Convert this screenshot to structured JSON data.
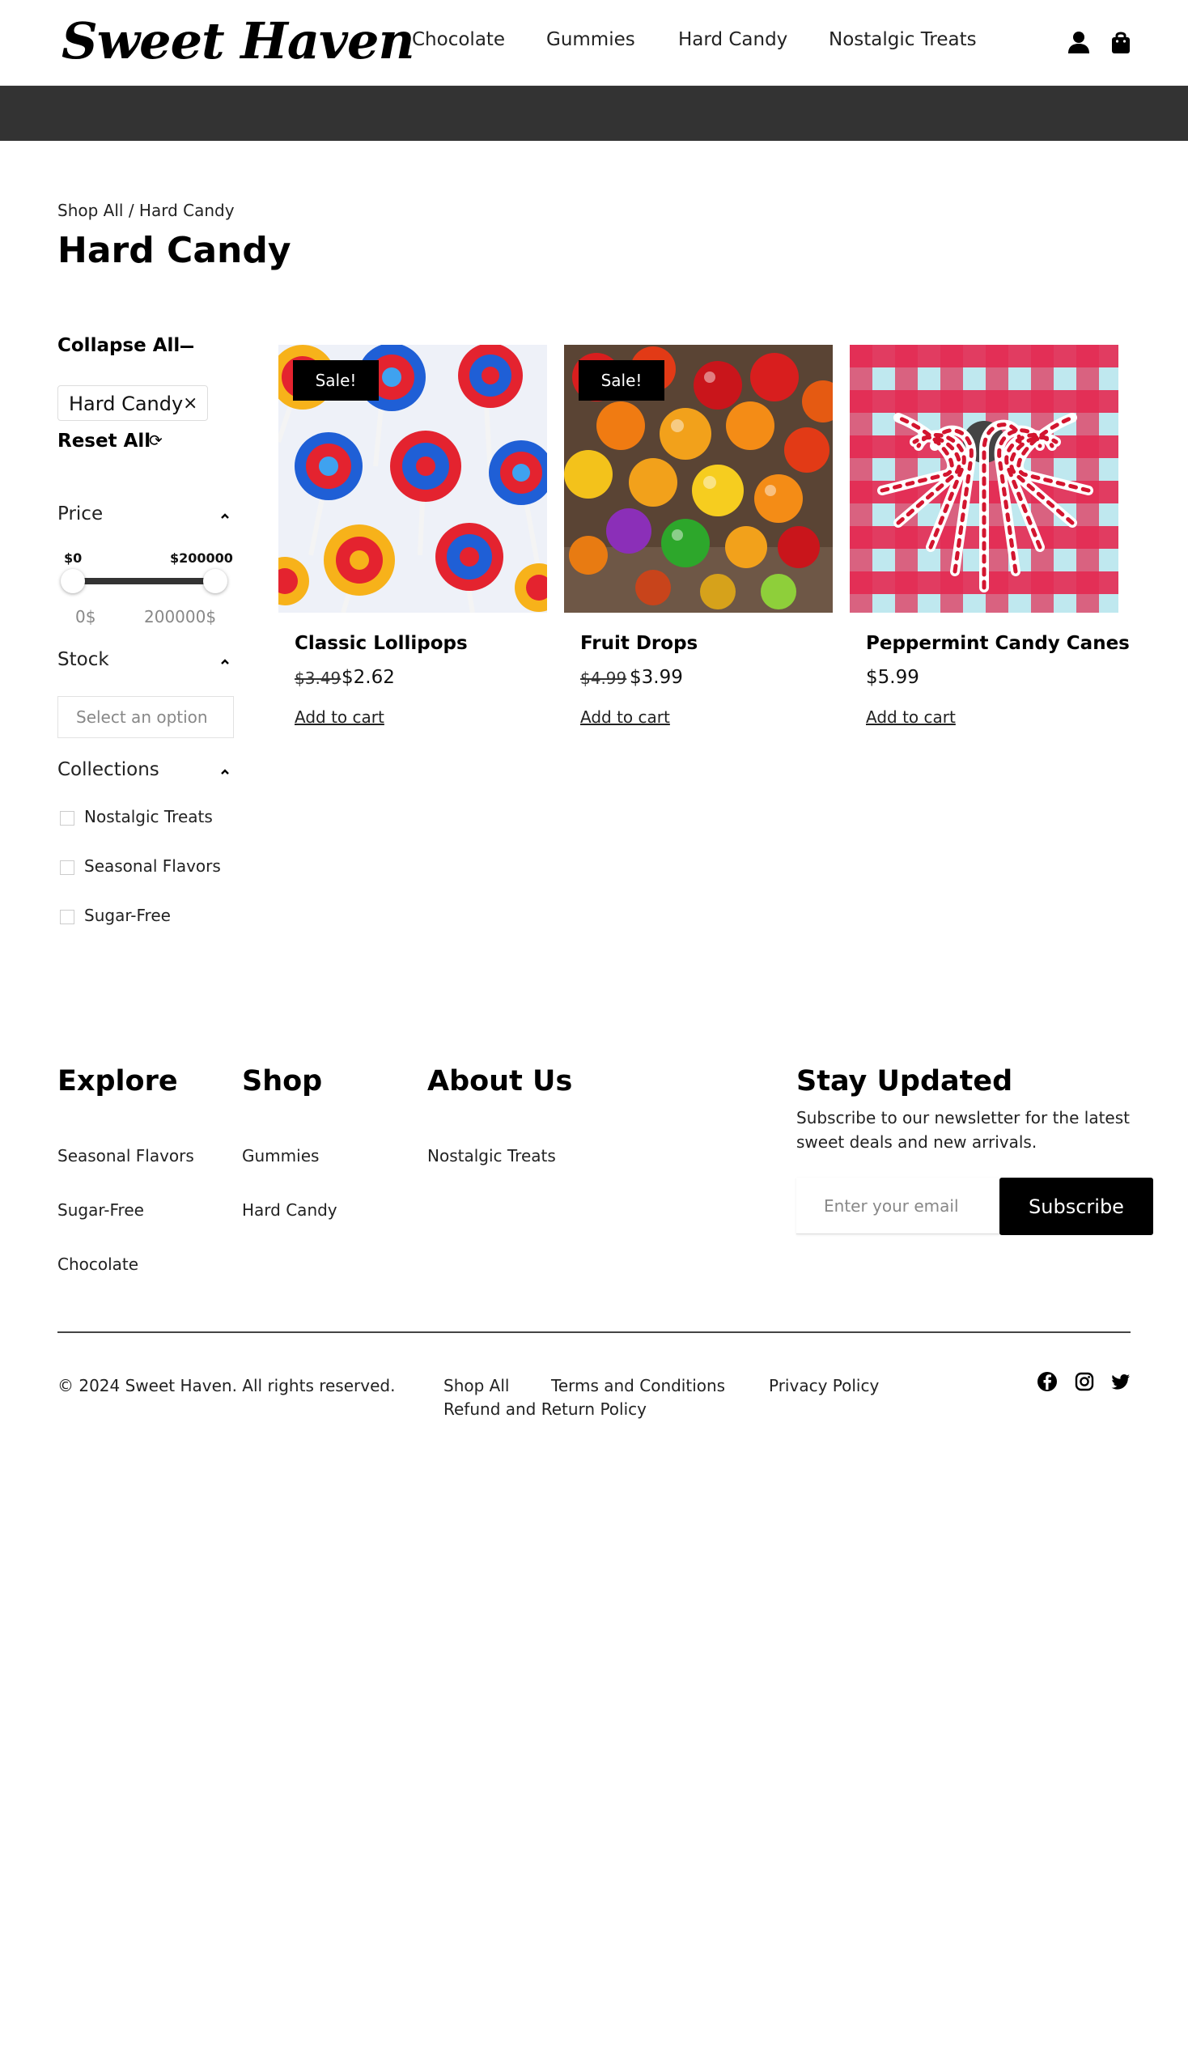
{
  "brand": {
    "logo": "Sweet Haven"
  },
  "nav": {
    "items": [
      "Chocolate",
      "Gummies",
      "Hard Candy",
      "Nostalgic Treats"
    ]
  },
  "header_icons": [
    "user-icon",
    "shopping-bag-icon"
  ],
  "breadcrumb": "Shop All / Hard Candy",
  "page_title": "Hard Candy",
  "filters": {
    "collapse_all": "Collapse All",
    "active_chip": "Hard Candy",
    "chip_close": "×",
    "reset_all": "Reset All",
    "reset_icon": "⟳",
    "price": {
      "heading": "Price",
      "min_label": "$0",
      "max_label": "$200000",
      "range_min_text": "0$",
      "range_max_text": "200000$"
    },
    "stock": {
      "heading": "Stock",
      "placeholder": "Select an option"
    },
    "collections": {
      "heading": "Collections",
      "options": [
        "Nostalgic Treats",
        "Seasonal Flavors",
        "Sugar-Free"
      ]
    }
  },
  "products": [
    {
      "name": "Classic Lollipops",
      "sale_badge": "Sale!",
      "old_price": "$3.49",
      "price": "$2.62",
      "cta": "Add to cart"
    },
    {
      "name": "Fruit Drops",
      "sale_badge": "Sale!",
      "old_price": "$4.99",
      "price": "$3.99",
      "cta": "Add to cart"
    },
    {
      "name": "Peppermint Candy Canes",
      "price": "$5.99",
      "cta": "Add to cart"
    }
  ],
  "footer": {
    "explore": {
      "heading": "Explore",
      "links": [
        "Seasonal Flavors",
        "Sugar-Free",
        "Chocolate"
      ]
    },
    "shop": {
      "heading": "Shop",
      "links": [
        "Gummies",
        "Hard Candy"
      ]
    },
    "about": {
      "heading": "About Us",
      "links": [
        "Nostalgic Treats"
      ]
    },
    "newsletter": {
      "heading": "Stay Updated",
      "text": "Subscribe to our newsletter for the latest sweet deals and new arrivals.",
      "placeholder": "Enter your email",
      "button": "Subscribe"
    },
    "copyright": "© 2024 Sweet Haven. All rights reserved.",
    "legal_links": [
      "Shop All",
      "Terms and Conditions",
      "Privacy Policy",
      "Refund and Return Policy"
    ],
    "social_icons": [
      "facebook-icon",
      "instagram-icon",
      "twitter-icon"
    ]
  },
  "colors": {
    "banner": "#333333",
    "badge": "#000000",
    "accent": "#000000"
  }
}
